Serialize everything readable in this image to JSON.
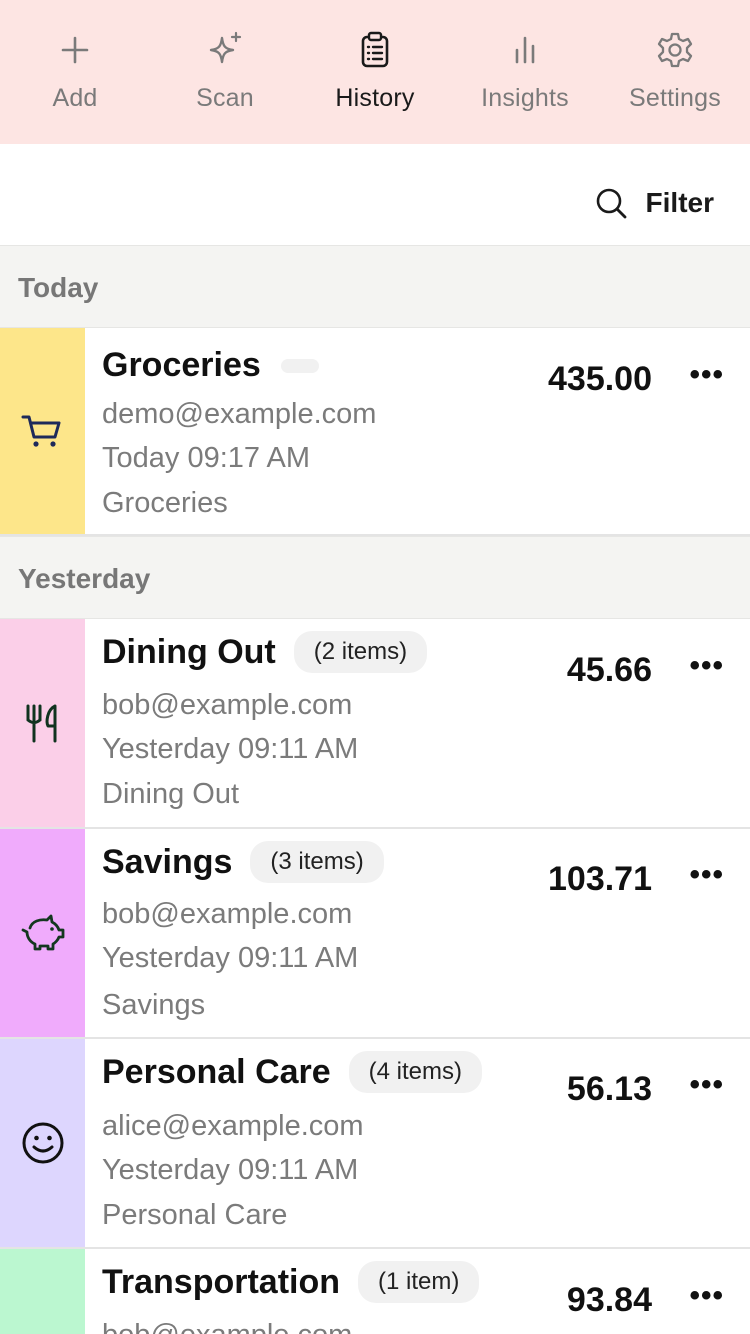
{
  "nav": {
    "items": [
      {
        "label": "Add",
        "icon": "plus-icon"
      },
      {
        "label": "Scan",
        "icon": "sparkle-icon"
      },
      {
        "label": "History",
        "icon": "clipboard-list-icon",
        "active": true
      },
      {
        "label": "Insights",
        "icon": "bar-chart-icon"
      },
      {
        "label": "Settings",
        "icon": "gear-icon"
      }
    ]
  },
  "filter": {
    "label": "Filter",
    "icon": "search-icon"
  },
  "sections": [
    {
      "label": "Today",
      "rows": [
        {
          "title": "Groceries",
          "badge": "",
          "email": "demo@example.com",
          "time": "Today 09:17 AM",
          "category": "Groceries",
          "amount": "435.00",
          "more": "•••",
          "icon": "shopping-cart-icon",
          "color": "#fde68a"
        }
      ]
    },
    {
      "label": "Yesterday",
      "rows": [
        {
          "title": "Dining Out",
          "badge": "(2 items)",
          "email": "bob@example.com",
          "time": "Yesterday 09:11 AM",
          "category": "Dining Out",
          "amount": "45.66",
          "more": "•••",
          "icon": "utensils-icon",
          "color": "#fbcfe8"
        },
        {
          "title": "Savings",
          "badge": "(3 items)",
          "email": "bob@example.com",
          "time": "Yesterday 09:11 AM",
          "category": "Savings",
          "amount": "103.71",
          "more": "•••",
          "icon": "piggy-bank-icon",
          "color": "#f0abfc"
        },
        {
          "title": "Personal Care",
          "badge": "(4 items)",
          "email": "alice@example.com",
          "time": "Yesterday 09:11 AM",
          "category": "Personal Care",
          "amount": "56.13",
          "more": "•••",
          "icon": "smile-icon",
          "color": "#ddd6fe"
        },
        {
          "title": "Transportation",
          "badge": "(1 item)",
          "email": "bob@example.com",
          "time": "",
          "category": "",
          "amount": "93.84",
          "more": "•••",
          "icon": "",
          "color": "#bbf7d0"
        }
      ]
    }
  ]
}
